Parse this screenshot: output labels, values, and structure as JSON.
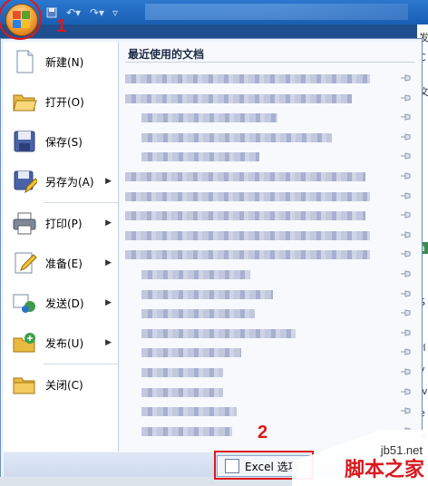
{
  "annotations": {
    "step1": "1",
    "step2": "2"
  },
  "menu": {
    "items": [
      {
        "id": "new",
        "label": "新建(N)",
        "icon": "new-document-icon",
        "arrow": ""
      },
      {
        "id": "open",
        "label": "打开(O)",
        "icon": "open-folder-icon",
        "arrow": ""
      },
      {
        "id": "save",
        "label": "保存(S)",
        "icon": "save-disk-icon",
        "arrow": ""
      },
      {
        "id": "saveas",
        "label": "另存为(A)",
        "icon": "save-as-icon",
        "arrow": "▶"
      },
      {
        "id": "print",
        "label": "打印(P)",
        "icon": "printer-icon",
        "arrow": "▶"
      },
      {
        "id": "prepare",
        "label": "准备(E)",
        "icon": "prepare-icon",
        "arrow": "▶"
      },
      {
        "id": "send",
        "label": "发送(D)",
        "icon": "send-icon",
        "arrow": "▶"
      },
      {
        "id": "publish",
        "label": "发布(U)",
        "icon": "publish-icon",
        "arrow": "▶"
      },
      {
        "id": "close",
        "label": "关闭(C)",
        "icon": "close-folder-icon",
        "arrow": ""
      }
    ],
    "recent_title": "最近使用的文档",
    "options_button": "Excel 选项",
    "options_red_label": "Excel 选项("
  },
  "sheet_edge": [
    "发",
    "C",
    "文",
    "",
    "a",
    "S",
    "",
    "rl",
    "y",
    "lv",
    "e",
    "N"
  ],
  "watermark": {
    "url": "jb51.net",
    "cn": "脚本之家"
  },
  "colors": {
    "annotation": "#e01818",
    "titlebar": "#2b78cf"
  }
}
